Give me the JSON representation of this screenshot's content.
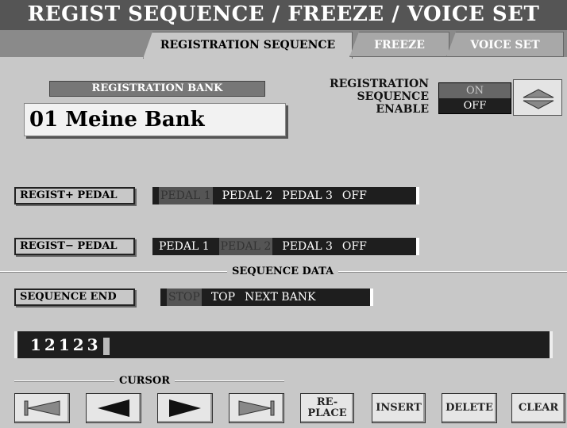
{
  "title": "REGIST SEQUENCE / FREEZE / VOICE SET",
  "tabs": [
    {
      "label": "REGISTRATION SEQUENCE",
      "active": true
    },
    {
      "label": "FREEZE",
      "active": false
    },
    {
      "label": "VOICE SET",
      "active": false
    }
  ],
  "registration_bank": {
    "label": "REGISTRATION BANK",
    "value": "01 Meine Bank"
  },
  "sequence_enable": {
    "label_line1": "REGISTRATION",
    "label_line2": "SEQUENCE",
    "label_line3": "ENABLE",
    "options": [
      "ON",
      "OFF"
    ],
    "selected": "ON"
  },
  "regist_plus_pedal": {
    "label": "REGIST+ PEDAL",
    "options": [
      "PEDAL 1",
      "PEDAL 2",
      "PEDAL 3",
      "OFF"
    ],
    "selected": "PEDAL 1"
  },
  "regist_minus_pedal": {
    "label": "REGIST− PEDAL",
    "options": [
      "PEDAL 1",
      "PEDAL 2",
      "PEDAL 3",
      "OFF"
    ],
    "selected": "PEDAL 2"
  },
  "sequence_data_title": "SEQUENCE DATA",
  "sequence_end": {
    "label": "SEQUENCE END",
    "options": [
      "STOP",
      "TOP",
      "NEXT BANK"
    ],
    "selected": "STOP"
  },
  "sequence_value": "12123",
  "cursor_label": "CURSOR",
  "buttons": {
    "replace_line1": "RE-",
    "replace_line2": "PLACE",
    "insert": "INSERT",
    "delete": "DELETE",
    "clear": "CLEAR"
  },
  "colors": {
    "title_bg": "#555555",
    "panel_bg": "#c8c8c8",
    "display_bg": "#1e1e1e"
  }
}
